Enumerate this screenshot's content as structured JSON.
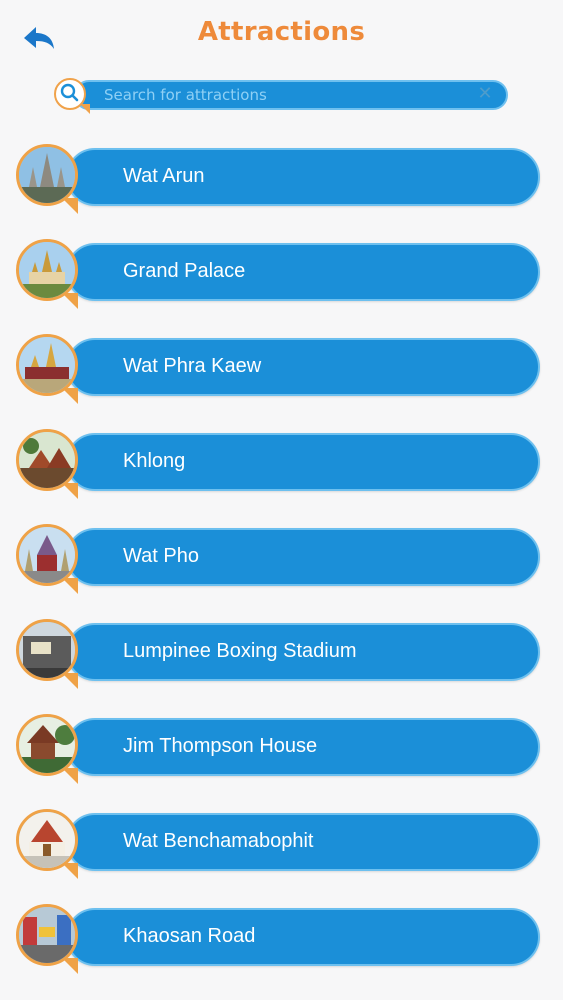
{
  "header": {
    "title": "Attractions",
    "back_icon": "back-arrow-icon"
  },
  "search": {
    "placeholder": "Search for attractions",
    "value": "",
    "clear_icon": "close-icon",
    "icon": "search-icon"
  },
  "attractions": [
    {
      "label": "Wat Arun"
    },
    {
      "label": "Grand Palace"
    },
    {
      "label": "Wat Phra Kaew"
    },
    {
      "label": "Khlong"
    },
    {
      "label": "Wat Pho"
    },
    {
      "label": "Lumpinee Boxing Stadium"
    },
    {
      "label": "Jim Thompson House"
    },
    {
      "label": "Wat Benchamabophit"
    },
    {
      "label": "Khaosan Road"
    }
  ],
  "colors": {
    "accent": "#1b8fd8",
    "title": "#ee8a3a",
    "badge_border": "#efa247"
  }
}
